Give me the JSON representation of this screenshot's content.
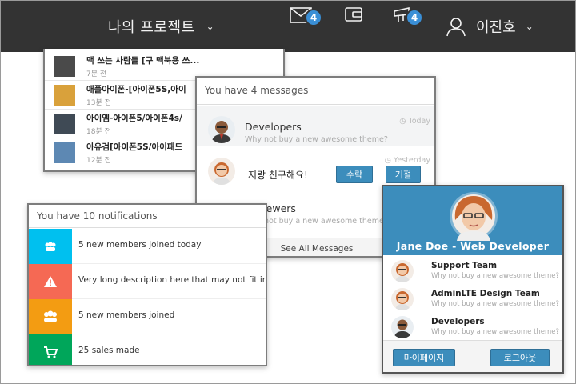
{
  "navbar": {
    "project_label": "나의 프로젝트",
    "mail_badge": "4",
    "bell_badge": "4",
    "user_name": "이진호"
  },
  "products": [
    {
      "title": "맥 쓰는 사람들 [구 맥북용 쓰...",
      "time": "7분 전",
      "thumb_color": "#4a4a4a"
    },
    {
      "title": "애플아이폰-[아이폰5S,아이",
      "time": "13분 전",
      "thumb_color": "#d9a13b"
    },
    {
      "title": "아이엠-아이폰5/아이폰4s/",
      "time": "18분 전",
      "thumb_color": "#3f4a55"
    },
    {
      "title": "아유검[아이폰5S/아이패드",
      "time": "12분 전",
      "thumb_color": "#5d88b3"
    }
  ],
  "messages": {
    "header": "You have 4 messages",
    "items": [
      {
        "name": "Developers",
        "sub": "Why not buy a new awesome theme?",
        "time": "Today"
      },
      {
        "time": "Yesterday",
        "friend_text": "저랑 친구해요!",
        "accept": "수락",
        "reject": "거절"
      },
      {
        "name": "Reviewers",
        "sub": "Why not buy a new awesome theme?"
      }
    ],
    "footer": "See All Messages"
  },
  "notifications": {
    "header": "You have 10 notifications",
    "items": [
      {
        "text": "5 new members joined today",
        "color": "#00c0ef",
        "icon": "users-icon"
      },
      {
        "text": "Very long description here that may not fit in",
        "color": "#f56954",
        "icon": "warning-icon"
      },
      {
        "text": "5 new members joined",
        "color": "#f39c12",
        "icon": "group-icon"
      },
      {
        "text": "25 sales made",
        "color": "#00a65a",
        "icon": "cart-icon"
      }
    ]
  },
  "user_panel": {
    "header_name": "Jane Doe - Web Developer",
    "teams": [
      {
        "name": "Support Team",
        "sub": "Why not buy a new awesome theme?"
      },
      {
        "name": "AdminLTE Design Team",
        "sub": "Why not buy a new awesome theme?"
      },
      {
        "name": "Developers",
        "sub": "Why not buy a new awesome theme?"
      }
    ],
    "mypage_label": "마이페이지",
    "logout_label": "로그아웃"
  },
  "colors": {
    "navbar": "#333333",
    "accent": "#3c8dbc",
    "badge": "#3a8fd6"
  }
}
